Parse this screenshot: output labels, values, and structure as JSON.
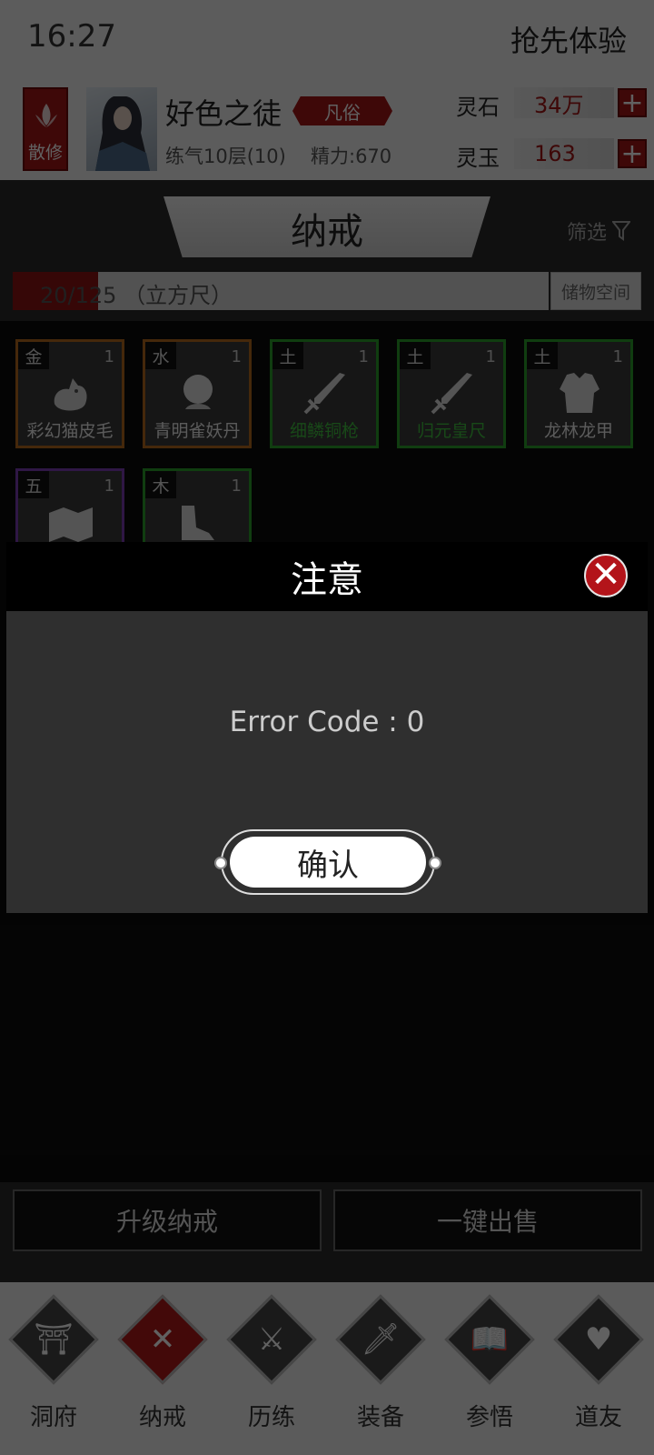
{
  "status": {
    "time": "16:27",
    "early_access": "抢先体验"
  },
  "player": {
    "sect": "散修",
    "name": "好色之徒",
    "rank": "凡俗",
    "level": "练气10层(10)",
    "energy": "精力:670"
  },
  "resources": [
    {
      "label": "灵石",
      "value": "34万"
    },
    {
      "label": "灵玉",
      "value": "163"
    }
  ],
  "page": {
    "title": "纳戒",
    "filter": "筛选"
  },
  "capacity": {
    "text": "20/125 （立方尺）",
    "fill_fraction": 0.16,
    "storage_label": "储物空间"
  },
  "items": [
    {
      "element": "金",
      "count": "1",
      "name": "彩幻猫皮毛",
      "border": "#b56a1e",
      "name_color": "#eeeeee",
      "icon": "cat-fur-icon"
    },
    {
      "element": "水",
      "count": "1",
      "name": "青明雀妖丹",
      "border": "#b56a1e",
      "name_color": "#eeeeee",
      "icon": "orb-icon"
    },
    {
      "element": "土",
      "count": "1",
      "name": "细鳞铜枪",
      "border": "#2aa02a",
      "name_color": "#3fbf3f",
      "icon": "sword-icon"
    },
    {
      "element": "土",
      "count": "1",
      "name": "归元皇尺",
      "border": "#2aa02a",
      "name_color": "#3fbf3f",
      "icon": "sword-icon"
    },
    {
      "element": "土",
      "count": "1",
      "name": "龙林龙甲",
      "border": "#2aa02a",
      "name_color": "#eeeeee",
      "icon": "armor-icon"
    },
    {
      "element": "五",
      "count": "1",
      "name": "",
      "border": "#7d3db5",
      "name_color": "#eeeeee",
      "icon": "map-scroll-icon"
    },
    {
      "element": "木",
      "count": "1",
      "name": "",
      "border": "#2aa02a",
      "name_color": "#eeeeee",
      "icon": "boots-icon"
    }
  ],
  "actions": {
    "upgrade": "升级纳戒",
    "sell_all": "一键出售"
  },
  "nav": [
    {
      "label": "洞府",
      "icon": "gate-icon",
      "glyph": "⛩"
    },
    {
      "label": "纳戒",
      "icon": "close-x-icon",
      "glyph": "✕"
    },
    {
      "label": "历练",
      "icon": "crossed-swords-icon",
      "glyph": "⚔"
    },
    {
      "label": "装备",
      "icon": "dagger-icon",
      "glyph": "🗡"
    },
    {
      "label": "参悟",
      "icon": "book-icon",
      "glyph": "📖"
    },
    {
      "label": "道友",
      "icon": "handshake-icon",
      "glyph": "♥"
    }
  ],
  "modal": {
    "title": "注意",
    "message": "Error Code : 0",
    "confirm": "确认"
  },
  "colors": {
    "accent_red": "#a31616",
    "dark_bg": "#0c0c0c",
    "panel": "#2f2f2f"
  }
}
